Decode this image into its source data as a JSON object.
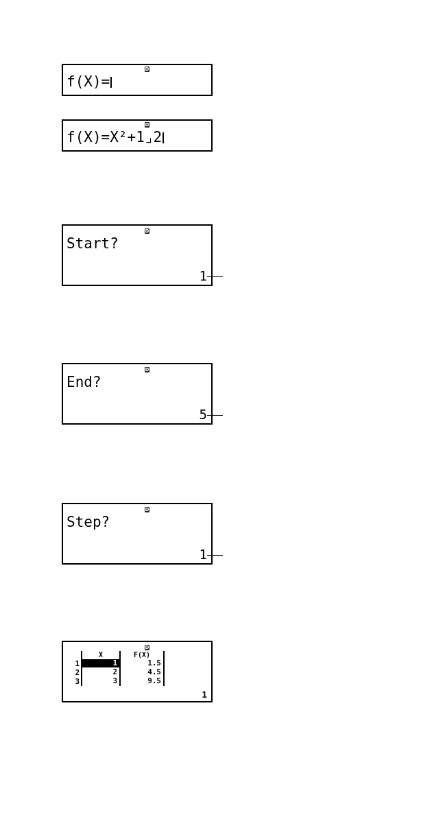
{
  "screens": [
    {
      "kind": "expression",
      "indicator": "D",
      "expression": "f(X)=",
      "cursor": true
    },
    {
      "kind": "expression",
      "indicator": "D",
      "expression": "f(X)=X²+1⌟2",
      "cursor": true
    },
    {
      "kind": "prompt",
      "indicator": "D",
      "prompt": "Start?",
      "value": "1",
      "leader_line": true
    },
    {
      "kind": "prompt",
      "indicator": "D",
      "prompt": "End?",
      "value": "5",
      "leader_line": true
    },
    {
      "kind": "prompt",
      "indicator": "D",
      "prompt": "Step?",
      "value": "1",
      "leader_line": true
    },
    {
      "kind": "table",
      "indicator": "D",
      "columns": [
        "X",
        "F(X)"
      ],
      "rows": [
        {
          "number": "1",
          "cells": [
            "1",
            "1.5"
          ],
          "selected": true
        },
        {
          "number": "2",
          "cells": [
            "2",
            "4.5"
          ],
          "selected": false
        },
        {
          "number": "3",
          "cells": [
            "3",
            "9.5"
          ],
          "selected": false
        }
      ],
      "value": "1"
    }
  ]
}
